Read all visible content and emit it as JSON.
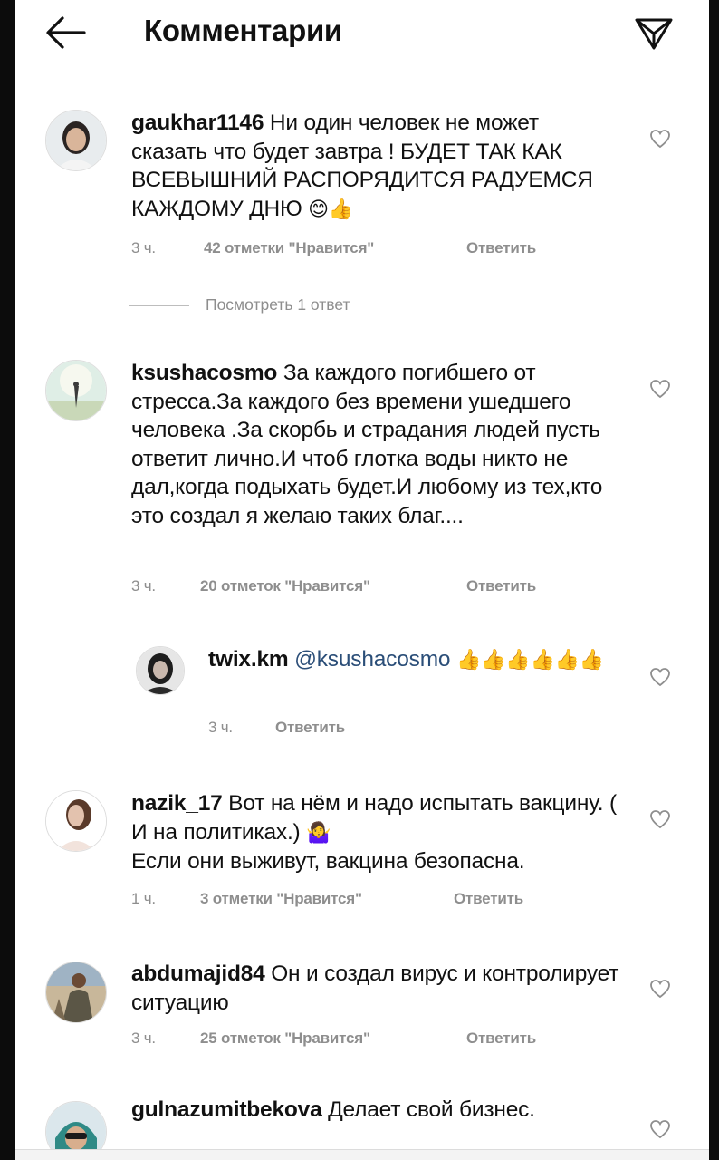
{
  "header": {
    "title": "Комментарии",
    "back_icon": "arrow-left-icon",
    "share_icon": "paper-plane-icon"
  },
  "comments": [
    {
      "username": "gaukhar1146",
      "text": "Ни один человек не может сказать что будет завтра ! БУДЕТ ТАК КАК ВСЕВЫШНИЙ РАСПОРЯДИТСЯ РАДУЕМСЯ КАЖДОМУ ДНЮ",
      "emoji": "😊👍",
      "time": "3 ч.",
      "likes": "42 отметки \"Нравится\"",
      "reply": "Ответить",
      "view_replies": "Посмотреть 1 ответ"
    },
    {
      "username": "ksushacosmo",
      "text": "За каждого погибшего от стресса.За каждого без времени ушедшего человека .За скорбь и страдания людей пусть ответит лично.И чтоб глотка воды никто не дал,когда подыхать будет.И любому из тех,кто это создал я желаю таких  благ....",
      "time": "3 ч.",
      "likes": "20 отметок \"Нравится\"",
      "reply": "Ответить"
    },
    {
      "username": "twix.km",
      "mention": "@ksushacosmo",
      "emoji": "👍👍👍👍👍👍",
      "time": "3 ч.",
      "reply": "Ответить"
    },
    {
      "username": "nazik_17",
      "text": "Вот на нём и надо испытать вакцину. ( И на политиках.)",
      "emoji": "🤷‍♀️",
      "text2": "Если они выживут, вакцина безопасна.",
      "time": "1 ч.",
      "likes": "3 отметки \"Нравится\"",
      "reply": "Ответить"
    },
    {
      "username": "abdumajid84",
      "text": "Он и создал вирус и контролирует ситуацию",
      "time": "3 ч.",
      "likes": "25 отметок \"Нравится\"",
      "reply": "Ответить"
    },
    {
      "username": "gulnazumitbekova",
      "text": "Делает свой бизнес."
    }
  ],
  "colors": {
    "text": "#111111",
    "meta": "#8e8e8e",
    "mention": "#2b4e78",
    "emoji_yellow": "#f5c21b"
  }
}
